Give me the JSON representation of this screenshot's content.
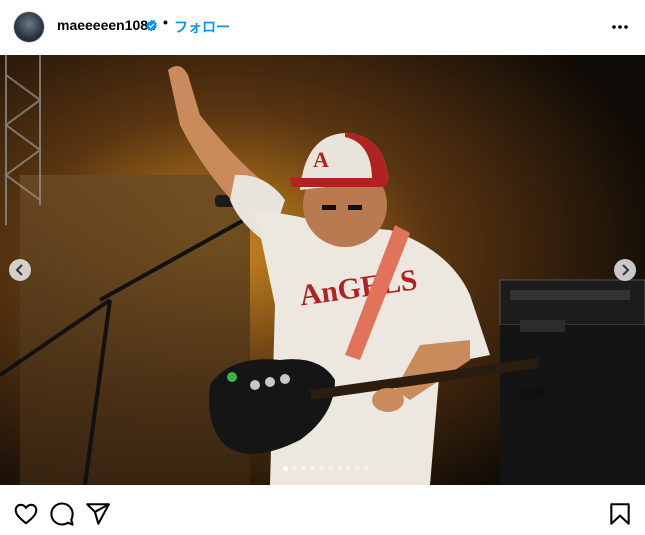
{
  "post": {
    "username": "maeeeeen1084",
    "separator": "•",
    "follow_label": "フォロー",
    "verified": true,
    "carousel": {
      "total_slides": 10,
      "current_slide": 1
    }
  },
  "icons": {
    "verified": "verified-badge-icon",
    "more": "more-options-icon",
    "prev": "chevron-left-icon",
    "next": "chevron-right-icon",
    "like": "heart-icon",
    "comment": "comment-icon",
    "share": "send-icon",
    "save": "bookmark-icon"
  },
  "colors": {
    "accent": "#0095f6",
    "text": "#000000"
  }
}
